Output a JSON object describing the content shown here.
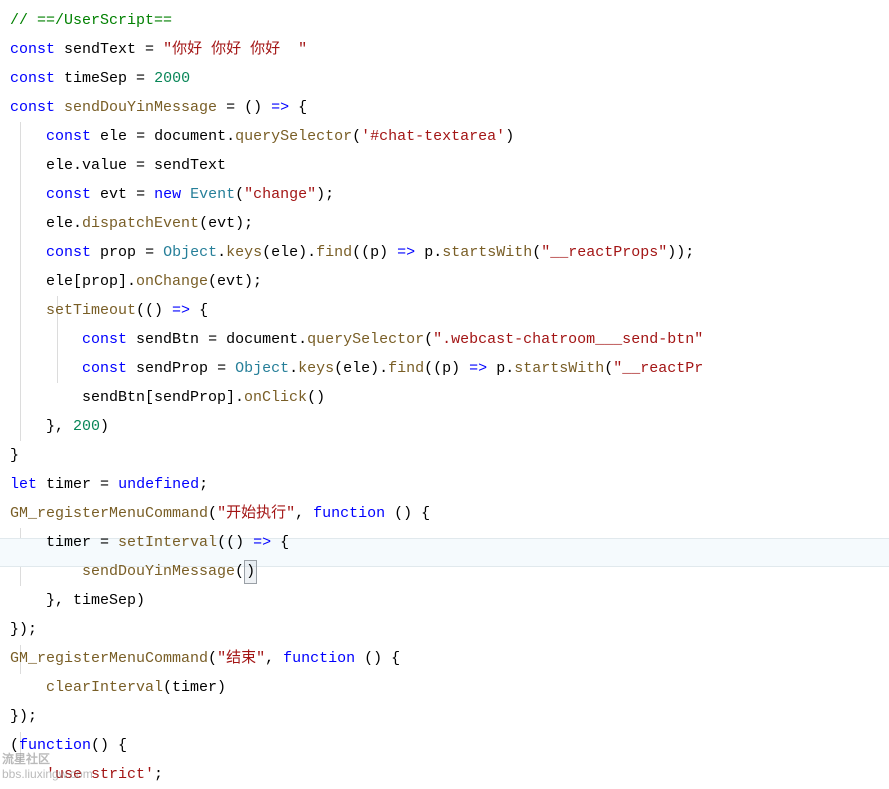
{
  "code": {
    "l1_comment": "// ==/UserScript==",
    "l2_kw1": "const",
    "l2_ident": "sendText",
    "l2_op": " = ",
    "l2_str": "\"你好 你好 你好  \"",
    "l3_kw1": "const",
    "l3_ident": "timeSep",
    "l3_op": " = ",
    "l3_num": "2000",
    "l4_kw1": "const",
    "l4_ident": "sendDouYinMessage",
    "l4_op1": " = ",
    "l4_paren": "()",
    "l4_arrow": " => ",
    "l4_brace": "{",
    "l5_kw": "const",
    "l5_ident": "ele",
    "l5_op": " = ",
    "l5_doc": "document",
    "l5_dot": ".",
    "l5_func": "querySelector",
    "l5_p1": "(",
    "l5_str": "'#chat-textarea'",
    "l5_p2": ")",
    "l6_txt1": "ele.value = sendText",
    "l7_kw": "const",
    "l7_ident": "evt",
    "l7_op": " = ",
    "l7_new": "new",
    "l7_sp": " ",
    "l7_type": "Event",
    "l7_p1": "(",
    "l7_str": "\"change\"",
    "l7_p2": ");",
    "l8_txt": "ele.",
    "l8_func": "dispatchEvent",
    "l8_rest": "(evt);",
    "l9_kw": "const",
    "l9_ident": "prop",
    "l9_op": " = ",
    "l9_obj": "Object",
    "l9_dot1": ".",
    "l9_keys": "keys",
    "l9_p1": "(ele).",
    "l9_find": "find",
    "l9_p2": "((p) ",
    "l9_arrow": "=>",
    "l9_p3": " p.",
    "l9_sw": "startsWith",
    "l9_p4": "(",
    "l9_str": "\"__reactProps\"",
    "l9_p5": "));",
    "l10_txt": "ele[prop].",
    "l10_func": "onChange",
    "l10_rest": "(evt);",
    "l11_func": "setTimeout",
    "l11_p1": "(() ",
    "l11_arrow": "=>",
    "l11_p2": " {",
    "l12_kw": "const",
    "l12_ident": "sendBtn",
    "l12_op": " = ",
    "l12_doc": "document",
    "l12_dot": ".",
    "l12_func": "querySelector",
    "l12_p1": "(",
    "l12_str": "\".webcast-chatroom___send-btn\"",
    "l13_kw": "const",
    "l13_ident": "sendProp",
    "l13_op": " = ",
    "l13_obj": "Object",
    "l13_dot": ".",
    "l13_keys": "keys",
    "l13_p1": "(ele).",
    "l13_find": "find",
    "l13_p2": "((p) ",
    "l13_arrow": "=>",
    "l13_p3": " p.",
    "l13_sw": "startsWith",
    "l13_p4": "(",
    "l13_str": "\"__reactPr",
    "l14_txt": "sendBtn[sendProp].",
    "l14_func": "onClick",
    "l14_rest": "()",
    "l15_txt": "}, ",
    "l15_num": "200",
    "l15_p": ")",
    "l16_txt": "}",
    "l17_kw": "let",
    "l17_ident": "timer",
    "l17_op": " = ",
    "l17_undef": "undefined",
    "l17_semi": ";",
    "l18_func": "GM_registerMenuCommand",
    "l18_p1": "(",
    "l18_str": "\"开始执行\"",
    "l18_p2": ", ",
    "l18_kw": "function",
    "l18_p3": " () {",
    "l19_txt1": "timer = ",
    "l19_func": "setInterval",
    "l19_p1": "(() ",
    "l19_arrow": "=>",
    "l19_p2": " {",
    "l20_func": "sendDouYinMessage",
    "l20_p1": "(",
    "l20_p2": ")",
    "l21_txt": "}, timeSep)",
    "l22_txt": "});",
    "l23_func": "GM_registerMenuCommand",
    "l23_p1": "(",
    "l23_str": "\"结束\"",
    "l23_p2": ", ",
    "l23_kw": "function",
    "l23_p3": " () {",
    "l24_func": "clearInterval",
    "l24_rest": "(timer)",
    "l25_txt": "});",
    "l26_p1": "(",
    "l26_kw": "function",
    "l26_p2": "() {",
    "l27_str": "'use strict'",
    "l27_semi": ";"
  },
  "watermark": {
    "line1": "流星社区",
    "line2": "bbs.liuxingw.com"
  }
}
